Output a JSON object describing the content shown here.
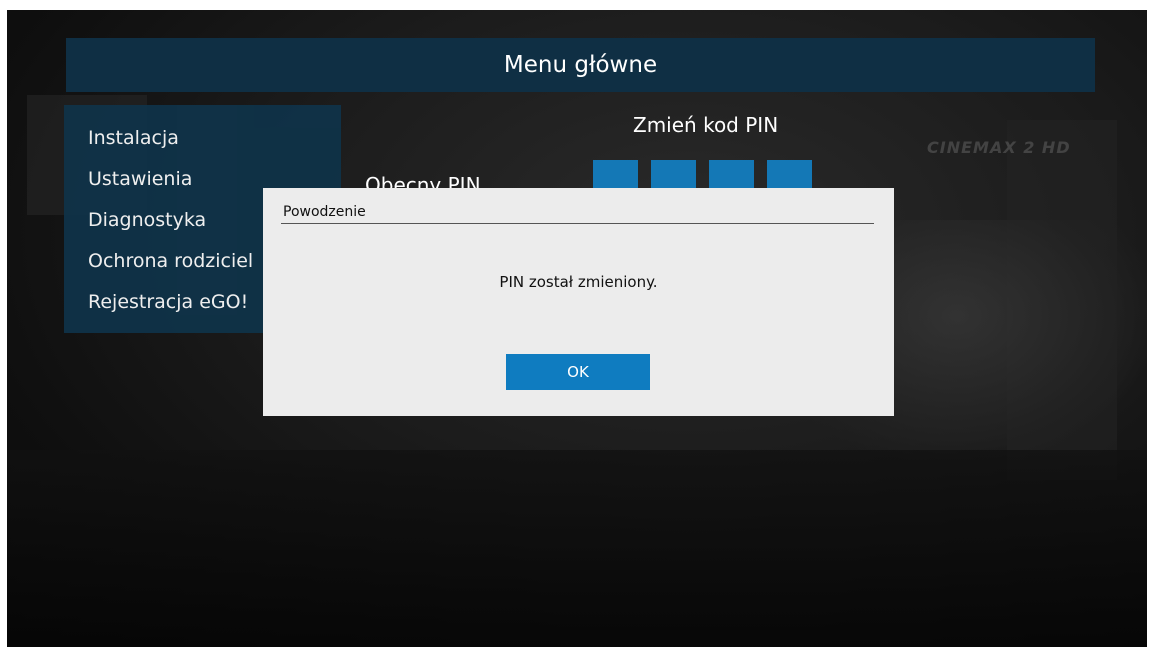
{
  "header": {
    "title": "Menu główne"
  },
  "sidebar": {
    "items": [
      {
        "label": "Instalacja"
      },
      {
        "label": "Ustawienia"
      },
      {
        "label": "Diagnostyka"
      },
      {
        "label": "Ochrona rodziciel"
      },
      {
        "label": "Rejestracja eGO!"
      }
    ]
  },
  "pin_panel": {
    "title": "Zmień kod PIN",
    "current_pin_label": "Obecny PIN",
    "digit_count": 4,
    "box_color": "#1478b6"
  },
  "background": {
    "channel_logo": "CINEMAX 2 HD"
  },
  "dialog": {
    "title": "Powodzenie",
    "message": "PIN został zmieniony.",
    "ok_label": "OK",
    "button_color": "#0f7cc0"
  },
  "colors": {
    "header_bg": "#0f2f44",
    "sidebar_bg": "#0f3349",
    "dialog_bg": "#ececec"
  }
}
